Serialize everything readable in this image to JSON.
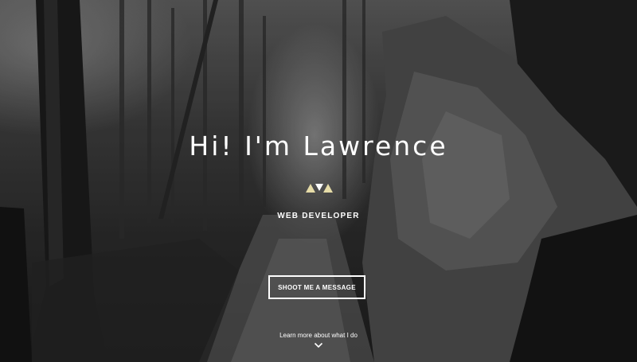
{
  "hero": {
    "title": "Hi! I'm Lawrence",
    "subtitle": "WEB DEVELOPER",
    "cta_label": "SHOOT ME A MESSAGE",
    "learn_more_label": "Learn more about what I do",
    "logo_icon": "triangles-logo-icon",
    "scroll_icon": "chevron-down-icon"
  },
  "colors": {
    "text": "#ffffff",
    "logo_accent": "#e6dca8"
  }
}
